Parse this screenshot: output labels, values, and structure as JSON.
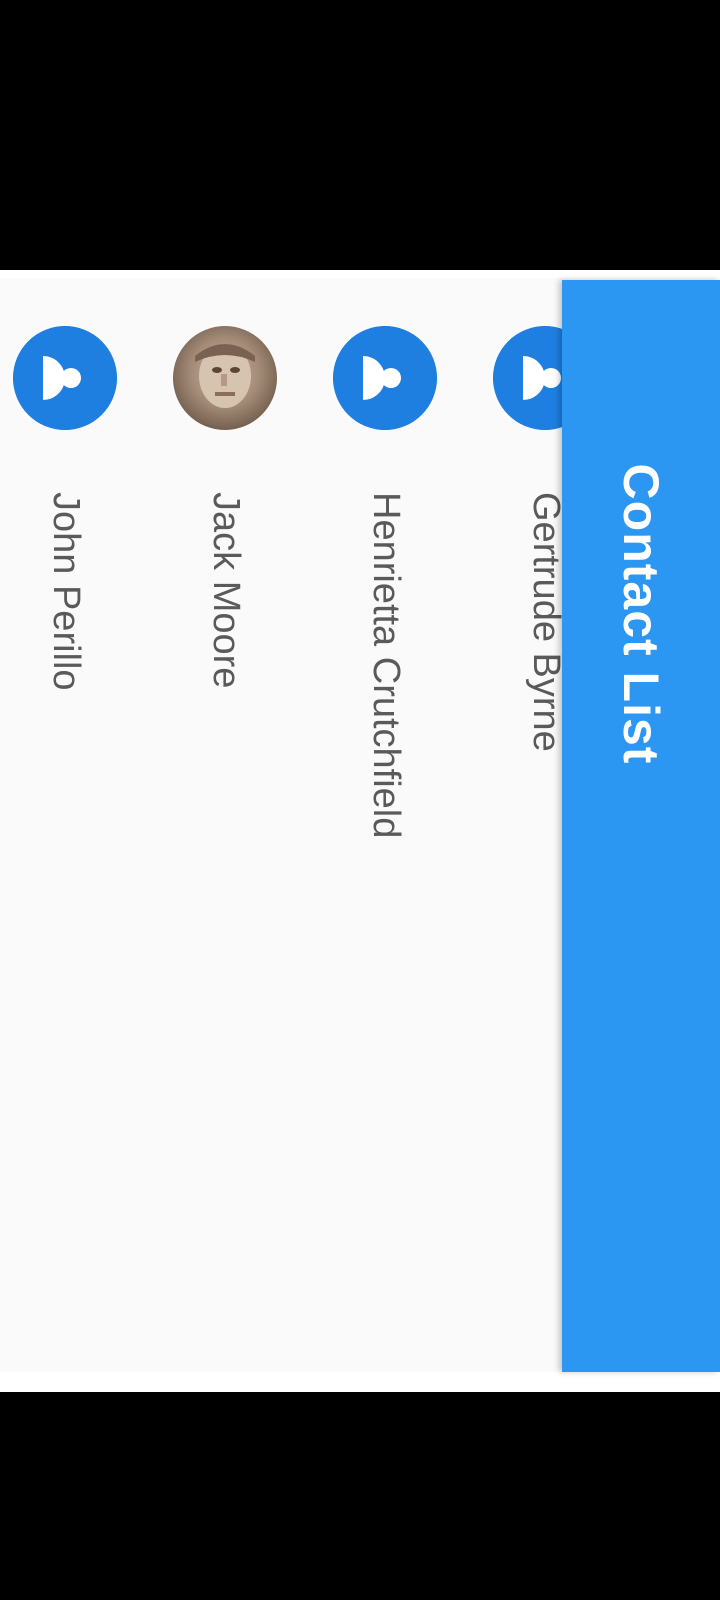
{
  "app_bar": {
    "title": "Contact List",
    "color": "#2b97f2"
  },
  "contacts": [
    {
      "name": "John Perillo",
      "avatar": "person-icon"
    },
    {
      "name": "Jack Moore",
      "avatar": "photo"
    },
    {
      "name": "Henrietta Crutchfield",
      "avatar": "person-icon"
    },
    {
      "name": "Gertrude Byrne",
      "avatar": "person-icon"
    }
  ],
  "colors": {
    "background": "#fafafa",
    "avatar": "#1f7fe0",
    "text": "#5a5a5a"
  }
}
